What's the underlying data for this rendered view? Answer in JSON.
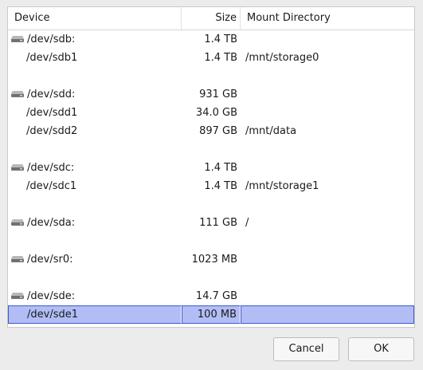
{
  "header": {
    "device": "Device",
    "size": "Size",
    "mount": "Mount Directory"
  },
  "rows": [
    {
      "type": "parent",
      "device": "/dev/sdb:",
      "size": "1.4 TB",
      "mount": "",
      "icon": "disk-icon"
    },
    {
      "type": "child",
      "device": "/dev/sdb1",
      "size": "1.4 TB",
      "mount": "/mnt/storage0"
    },
    {
      "type": "spacer"
    },
    {
      "type": "parent",
      "device": "/dev/sdd:",
      "size": "931 GB",
      "mount": "",
      "icon": "disk-icon"
    },
    {
      "type": "child",
      "device": "/dev/sdd1",
      "size": "34.0 GB",
      "mount": ""
    },
    {
      "type": "child",
      "device": "/dev/sdd2",
      "size": "897 GB",
      "mount": "/mnt/data"
    },
    {
      "type": "spacer"
    },
    {
      "type": "parent",
      "device": "/dev/sdc:",
      "size": "1.4 TB",
      "mount": "",
      "icon": "disk-icon"
    },
    {
      "type": "child",
      "device": "/dev/sdc1",
      "size": "1.4 TB",
      "mount": "/mnt/storage1"
    },
    {
      "type": "spacer"
    },
    {
      "type": "parent",
      "device": "/dev/sda:",
      "size": "111 GB",
      "mount": "/",
      "icon": "disk-icon"
    },
    {
      "type": "spacer"
    },
    {
      "type": "parent",
      "device": "/dev/sr0:",
      "size": "1023 MB",
      "mount": "",
      "icon": "disk-icon"
    },
    {
      "type": "spacer"
    },
    {
      "type": "parent",
      "device": "/dev/sde:",
      "size": "14.7 GB",
      "mount": "",
      "icon": "disk-icon"
    },
    {
      "type": "child",
      "device": "/dev/sde1",
      "size": "100 MB",
      "mount": "",
      "selected": true
    }
  ],
  "buttons": {
    "cancel": "Cancel",
    "ok": "OK"
  },
  "colors": {
    "selection_bg": "#b2bdf6",
    "selection_border": "#3d59c9"
  }
}
